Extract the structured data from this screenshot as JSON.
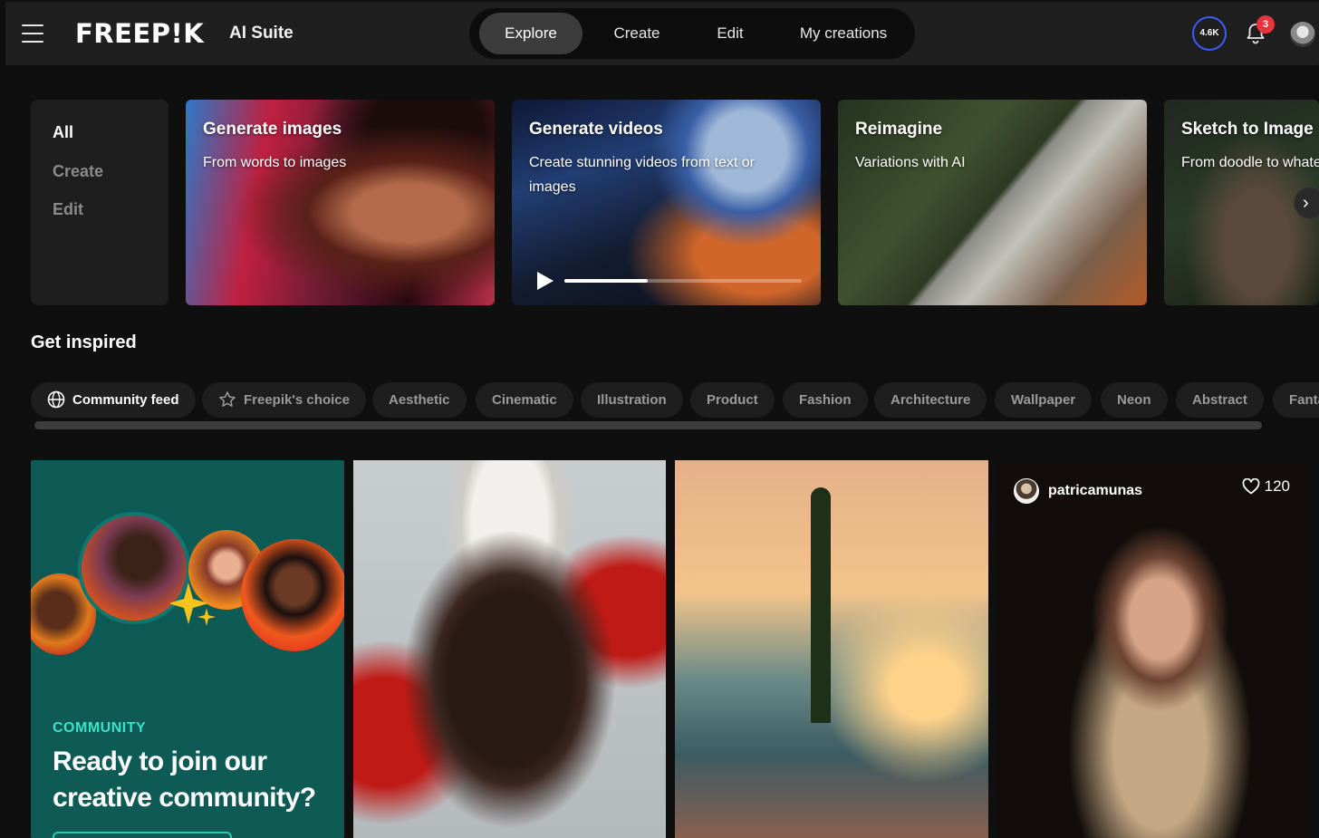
{
  "header": {
    "logo": "FREEP!K",
    "suite": "AI Suite",
    "nav": [
      {
        "label": "Explore",
        "active": true
      },
      {
        "label": "Create",
        "active": false
      },
      {
        "label": "Edit",
        "active": false
      },
      {
        "label": "My creations",
        "active": false
      }
    ],
    "credits": "4.6K",
    "notifications": "3"
  },
  "categories": [
    "All",
    "Create",
    "Edit"
  ],
  "features": [
    {
      "title": "Generate images",
      "subtitle": "From words to images"
    },
    {
      "title": "Generate videos",
      "subtitle": "Create stunning videos from text or images",
      "progress": 0.35
    },
    {
      "title": "Reimagine",
      "subtitle": "Variations with AI"
    },
    {
      "title": "Sketch to Image",
      "subtitle": "From doodle to whatever"
    }
  ],
  "section_title": "Get inspired",
  "chips": [
    {
      "label": "Community feed",
      "icon": "globe-icon",
      "active": true
    },
    {
      "label": "Freepik's choice",
      "icon": "star-icon",
      "active": false
    },
    {
      "label": "Aesthetic"
    },
    {
      "label": "Cinematic"
    },
    {
      "label": "Illustration"
    },
    {
      "label": "Product"
    },
    {
      "label": "Fashion"
    },
    {
      "label": "Architecture"
    },
    {
      "label": "Wallpaper"
    },
    {
      "label": "Neon"
    },
    {
      "label": "Abstract"
    },
    {
      "label": "Fantasy"
    }
  ],
  "community_card": {
    "label": "COMMUNITY",
    "title": "Ready to join our creative community?"
  },
  "gallery_post": {
    "username": "patricamunas",
    "likes": "120"
  },
  "colors": {
    "background": "#0f0f0f",
    "accent_teal": "#0e5a54",
    "community_label": "#3de0c8",
    "notification": "#e8343d",
    "credits_ring": "#3b5bff"
  }
}
